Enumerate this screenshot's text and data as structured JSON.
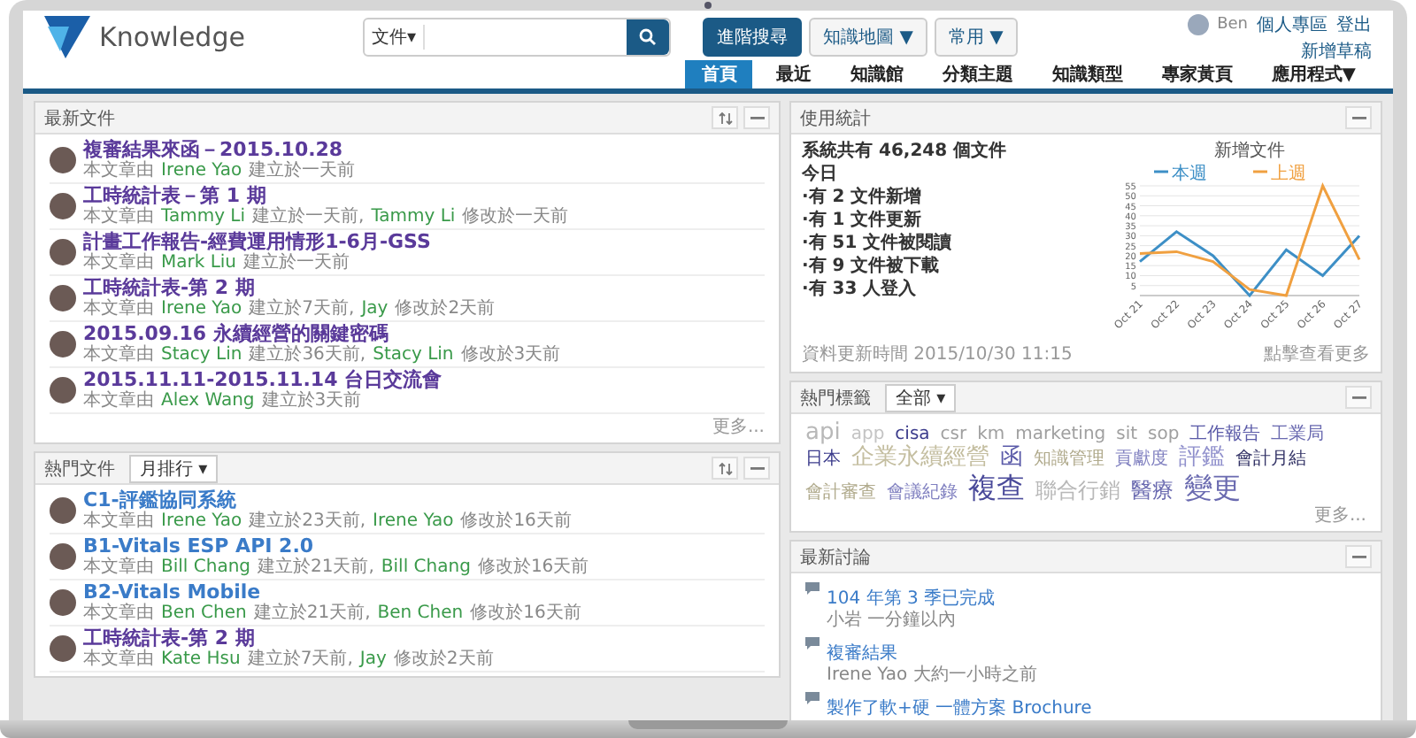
{
  "header": {
    "logo_text": "Knowledge",
    "search": {
      "scope": "文件▾"
    },
    "buttons": [
      {
        "label": "進階搜尋",
        "kind": "primary"
      },
      {
        "label": "知識地圖 ▼",
        "kind": "plain"
      },
      {
        "label": "常用 ▼",
        "kind": "plain"
      }
    ],
    "user": {
      "name": "Ben",
      "links": [
        "個人專區",
        "登出"
      ],
      "draft_link": "新增草稿"
    }
  },
  "tabs": [
    {
      "label": "首頁",
      "selected": true
    },
    {
      "label": "最近",
      "selected": false
    },
    {
      "label": "知識館",
      "selected": false
    },
    {
      "label": "分類主題",
      "selected": false
    },
    {
      "label": "知識類型",
      "selected": false
    },
    {
      "label": "專家黃頁",
      "selected": false
    },
    {
      "label": "應用程式▼",
      "selected": false
    }
  ],
  "latest_docs": {
    "title": "最新文件",
    "more": "更多...",
    "items": [
      {
        "title": "複審結果來函－2015.10.28",
        "visited": true,
        "by": "本文章由",
        "author": "Irene Yao",
        "created": "建立於一天前"
      },
      {
        "title": "工時統計表－第 1 期",
        "visited": true,
        "by": "本文章由",
        "author": "Tammy Li",
        "created": "建立於一天前,",
        "modifier": "Tammy Li",
        "modified": "修改於一天前"
      },
      {
        "title": "計畫工作報告-經費運用情形1-6月-GSS",
        "visited": true,
        "by": "本文章由",
        "author": "Mark Liu",
        "created": "建立於一天前"
      },
      {
        "title": "工時統計表-第 2 期",
        "visited": true,
        "by": "本文章由",
        "author": "Irene Yao",
        "created": "建立於7天前,",
        "modifier": "Jay",
        "modified": "修改於2天前"
      },
      {
        "title": "2015.09.16 永續經營的關鍵密碼",
        "visited": true,
        "by": "本文章由",
        "author": "Stacy Lin",
        "created": "建立於36天前,",
        "modifier": "Stacy Lin",
        "modified": "修改於3天前"
      },
      {
        "title": "2015.11.11-2015.11.14 台日交流會",
        "visited": true,
        "by": "本文章由",
        "author": "Alex Wang",
        "created": "建立於3天前"
      }
    ]
  },
  "hot_docs": {
    "title": "熱門文件",
    "filter": "月排行 ▾",
    "items": [
      {
        "title": "C1-評鑑協同系統",
        "visited": false,
        "by": "本文章由",
        "author": "Irene Yao",
        "created": "建立於23天前,",
        "modifier": "Irene Yao",
        "modified": "修改於16天前"
      },
      {
        "title": "B1-Vitals ESP API 2.0",
        "visited": false,
        "by": "本文章由",
        "author": "Bill Chang",
        "created": "建立於21天前,",
        "modifier": "Bill Chang",
        "modified": "修改於16天前"
      },
      {
        "title": "B2-Vitals Mobile",
        "visited": false,
        "by": "本文章由",
        "author": "Ben Chen",
        "created": "建立於21天前,",
        "modifier": "Ben Chen",
        "modified": "修改於16天前"
      },
      {
        "title": "工時統計表-第 2 期",
        "visited": true,
        "by": "本文章由",
        "author": "Kate Hsu",
        "created": "建立於7天前,",
        "modifier": "Jay",
        "modified": "修改於2天前"
      }
    ]
  },
  "usage_stats": {
    "title": "使用統計",
    "total": "系統共有 46,248 個文件",
    "today": "今日",
    "lines": [
      "·有 2 文件新增",
      "·有 1 文件更新",
      "·有 51 文件被閱讀",
      "·有 9 文件被下載",
      "·有 33 人登入"
    ],
    "updated": "資料更新時間 2015/10/30 11:15",
    "more": "點擊查看更多",
    "chart_data": {
      "type": "line",
      "title": "新增文件",
      "categories": [
        "Oct 21",
        "Oct 22",
        "Oct 23",
        "Oct 24",
        "Oct 25",
        "Oct 26",
        "Oct 27"
      ],
      "series": [
        {
          "name": "本週",
          "color": "#3d8fc6",
          "values": [
            17,
            32,
            20,
            0,
            23,
            10,
            30
          ]
        },
        {
          "name": "上週",
          "color": "#f0a040",
          "values": [
            21,
            22,
            17,
            3,
            0,
            55,
            18
          ]
        }
      ],
      "ylim": [
        0,
        55
      ],
      "grid": true,
      "legend": true,
      "yticks": [
        5,
        10,
        15,
        20,
        25,
        30,
        35,
        40,
        45,
        50,
        55
      ]
    }
  },
  "hot_tags": {
    "title": "熱門標籤",
    "filter": "全部 ▾",
    "more": "更多...",
    "tags": [
      {
        "label": "api",
        "kind": "l",
        "color": "#b8b8b8"
      },
      {
        "label": "app",
        "kind": "s",
        "color": "#c4c4c4"
      },
      {
        "label": "cisa",
        "kind": "s",
        "color": "#3c3c8c"
      },
      {
        "label": "csr",
        "kind": "s",
        "color": "#a0a0a0"
      },
      {
        "label": "km",
        "kind": "s",
        "color": "#a0a0a0"
      },
      {
        "label": "marketing",
        "kind": "s",
        "color": "#a0a0a0"
      },
      {
        "label": "sit",
        "kind": "s",
        "color": "#a0a0a0"
      },
      {
        "label": "sop",
        "kind": "s",
        "color": "#a0a0a0"
      },
      {
        "label": "工作報告",
        "kind": "s",
        "color": "#5a5aa8"
      },
      {
        "label": "工業局",
        "kind": "s",
        "color": "#6a6ab0"
      },
      {
        "label": "日本",
        "kind": "s",
        "color": "#3c3c8c"
      },
      {
        "label": "企業永續經營",
        "kind": "l",
        "color": "#c4bea0"
      },
      {
        "label": "函",
        "kind": "l",
        "color": "#5a5aa8"
      },
      {
        "label": "知識管理",
        "kind": "s",
        "color": "#b0aa8c"
      },
      {
        "label": "貢獻度",
        "kind": "s",
        "color": "#8080c0"
      },
      {
        "label": "評鑑",
        "kind": "l",
        "color": "#9090cc"
      },
      {
        "label": "會計月結",
        "kind": "s",
        "color": "#333366"
      },
      {
        "label": "會計審查",
        "kind": "s",
        "color": "#b0aa8c"
      },
      {
        "label": "會議紀錄",
        "kind": "s",
        "color": "#8080c0"
      },
      {
        "label": "複查",
        "kind": "xl",
        "color": "#4a4a9a"
      },
      {
        "label": "聯合行銷",
        "kind": "m",
        "color": "#b8b8b8"
      },
      {
        "label": "醫療",
        "kind": "m",
        "color": "#6a6ab0"
      },
      {
        "label": "變更",
        "kind": "xl",
        "color": "#6a6ab0"
      }
    ]
  },
  "discussions": {
    "title": "最新討論",
    "items": [
      {
        "title": "104 年第 3 季已完成",
        "meta": "小岩 一分鐘以內"
      },
      {
        "title": "複審結果",
        "meta": "Irene Yao 大約一小時之前"
      },
      {
        "title": "製作了軟+硬 一體方案 Brochure"
      }
    ]
  }
}
